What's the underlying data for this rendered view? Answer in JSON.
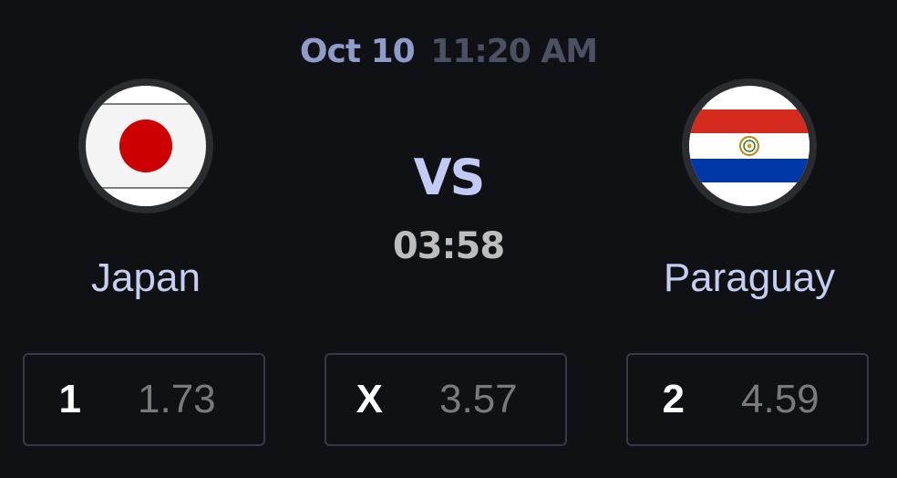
{
  "match": {
    "date": "Oct 10",
    "time": "11:20 AM",
    "vs_label": "VS",
    "countdown": "03:58"
  },
  "home_team": {
    "name": "Japan",
    "flag": "japan-flag-icon"
  },
  "away_team": {
    "name": "Paraguay",
    "flag": "paraguay-flag-icon"
  },
  "odds": [
    {
      "label": "1",
      "value": "1.73"
    },
    {
      "label": "X",
      "value": "3.57"
    },
    {
      "label": "2",
      "value": "4.59"
    }
  ],
  "colors": {
    "background": "#0f1115",
    "accent": "#c1cbf5",
    "date": "#8f9bc8",
    "time_muted": "#4b5062",
    "button_border": "#363b47",
    "odd_value": "#7a7a7a"
  }
}
